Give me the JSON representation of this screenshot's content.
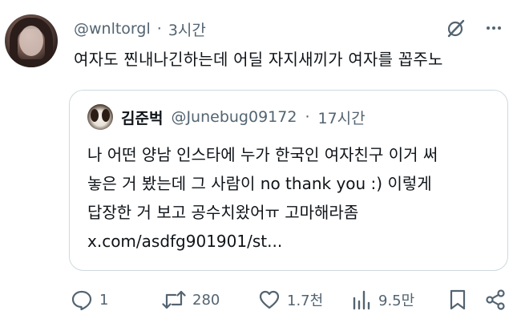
{
  "tweet": {
    "handle": "@wnltorgl",
    "separator": "·",
    "time": "3시간",
    "text": "여자도 찐내나긴하는데 어딜 자지새끼가 여자를 꼽주노"
  },
  "quote": {
    "display_name": "김준벅",
    "handle": "@Junebug09172",
    "separator": "·",
    "time": "17시간",
    "lines": [
      "나 어떤 양남 인스타에 누가 한국인 여자친구 이거 써",
      "놓은 거 봤는데 그 사람이 no thank you :) 이렇게",
      "답장한 거 보고 공수치왔어ㅠ 고마해라좀",
      "x.com/asdfg901901/st..."
    ]
  },
  "actions": {
    "replies": "1",
    "retweets": "280",
    "likes": "1.7천",
    "views": "9.5만"
  },
  "icons": [
    "grok-icon",
    "more-icon",
    "reply-icon",
    "retweet-icon",
    "like-icon",
    "views-icon",
    "bookmark-icon",
    "share-icon"
  ],
  "colors": {
    "text": "#0f1419",
    "muted": "#536471",
    "border": "#cfd9de"
  }
}
